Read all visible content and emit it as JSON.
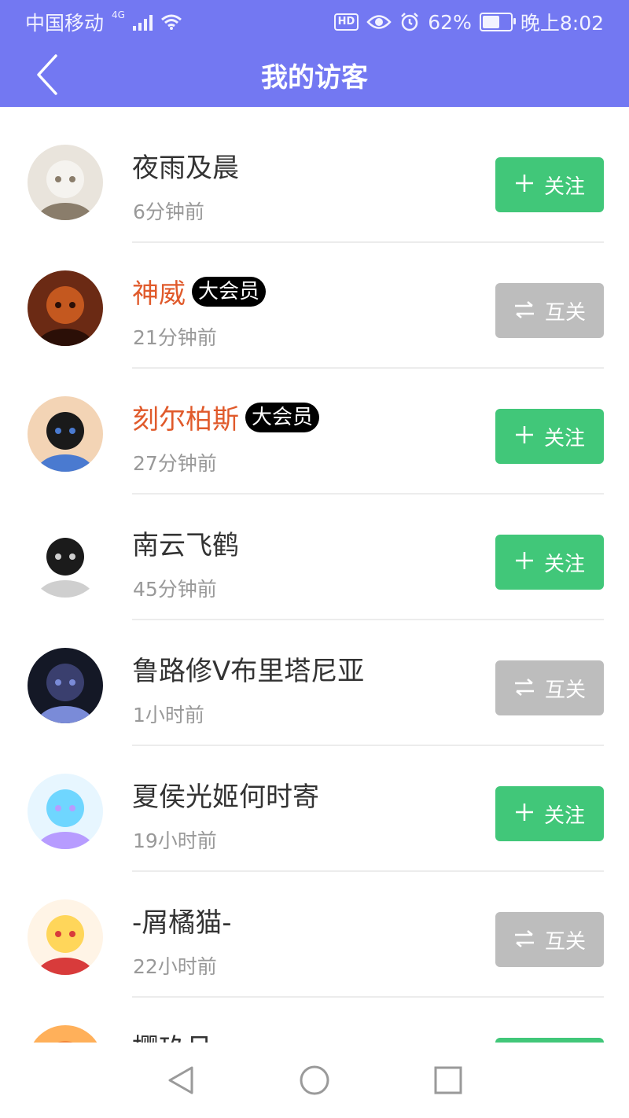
{
  "status_bar": {
    "carrier": "中国移动",
    "network": "4G",
    "battery": "62%",
    "time": "晚上8:02",
    "hd_label": "HD",
    "battery_level": 0.62
  },
  "header": {
    "title": "我的访客"
  },
  "colors": {
    "header_bg": "#7378f2",
    "follow_button": "#41c779",
    "mutual_button": "#bdbdbd",
    "vip_name": "#e05a2b"
  },
  "visitors": [
    {
      "name": "夜雨及晨",
      "vip": false,
      "badge": "",
      "time": "6分钟前",
      "action": "关注",
      "action_type": "follow",
      "avatar_icon": "anime-girl-white-hair-avatar"
    },
    {
      "name": "神威",
      "vip": true,
      "badge": "大会员",
      "time": "21分钟前",
      "action": "互关",
      "action_type": "mutual",
      "avatar_icon": "orange-dark-anime-avatar"
    },
    {
      "name": "刻尔柏斯",
      "vip": true,
      "badge": "大会员",
      "time": "27分钟前",
      "action": "关注",
      "action_type": "follow",
      "avatar_icon": "anime-boy-black-hair-avatar"
    },
    {
      "name": "南云飞鹤",
      "vip": false,
      "badge": "",
      "time": "45分钟前",
      "action": "关注",
      "action_type": "follow",
      "avatar_icon": "manga-glasses-avatar"
    },
    {
      "name": "鲁路修V布里塔尼亚",
      "vip": false,
      "badge": "",
      "time": "1小时前",
      "action": "互关",
      "action_type": "mutual",
      "avatar_icon": "dark-anime-character-avatar"
    },
    {
      "name": "夏侯光姬何时寄",
      "vip": false,
      "badge": "",
      "time": "19小时前",
      "action": "关注",
      "action_type": "follow",
      "avatar_icon": "blue-hair-anime-girl-avatar"
    },
    {
      "name": "-屑橘猫-",
      "vip": false,
      "badge": "",
      "time": "22小时前",
      "action": "互关",
      "action_type": "mutual",
      "avatar_icon": "blonde-anime-girl-avatar"
    },
    {
      "name": "樱玖月",
      "vip": false,
      "badge": "",
      "time": "",
      "action": "",
      "action_type": "follow",
      "avatar_icon": "orange-anime-avatar"
    }
  ],
  "nav_bar": {
    "back_icon": "triangle-back-icon",
    "home_icon": "circle-home-icon",
    "recents_icon": "square-recents-icon"
  }
}
